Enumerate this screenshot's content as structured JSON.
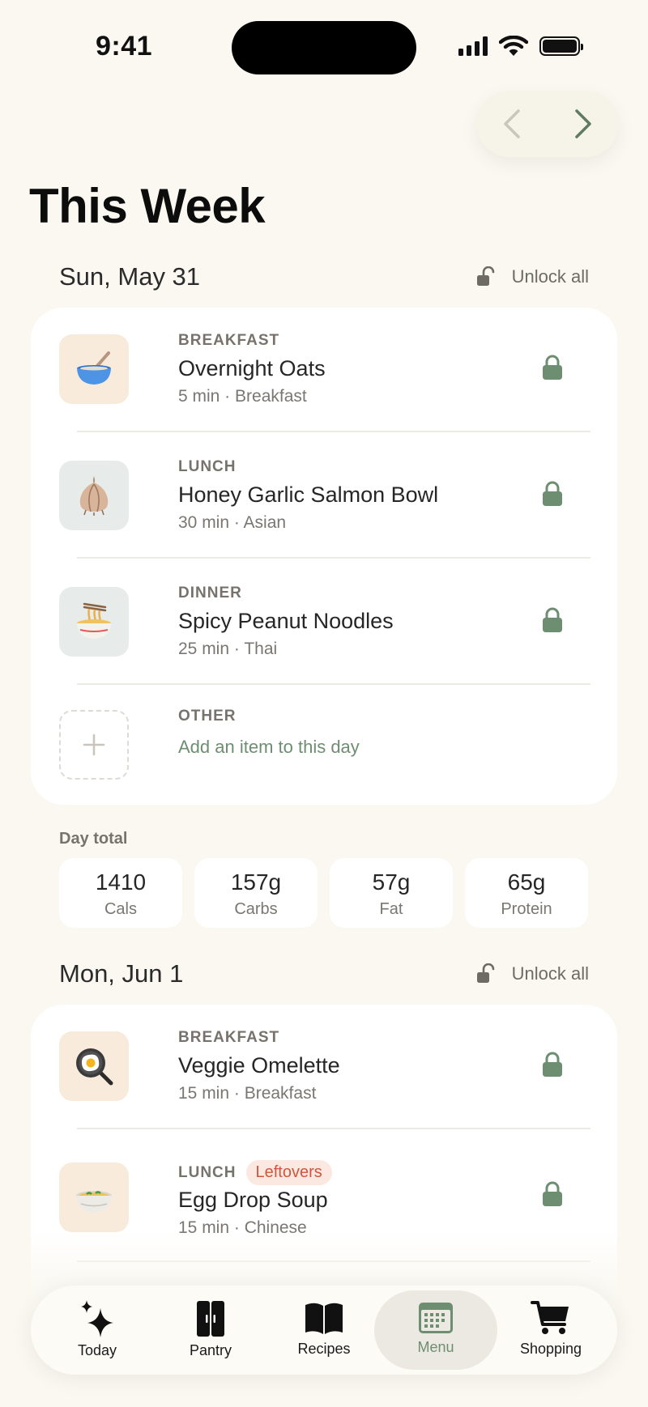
{
  "status_bar": {
    "time": "9:41"
  },
  "page_title": "This Week",
  "days": [
    {
      "title": "Sun, May 31",
      "unlock_label": "Unlock all",
      "meals": [
        {
          "type": "BREAKFAST",
          "name": "Overnight Oats",
          "sub": "5 min · Breakfast",
          "icon": "bowl-icon"
        },
        {
          "type": "LUNCH",
          "name": "Honey Garlic Salmon Bowl",
          "sub": "30 min · Asian",
          "icon": "garlic-icon"
        },
        {
          "type": "DINNER",
          "name": "Spicy Peanut Noodles",
          "sub": "25 min · Thai",
          "icon": "noodles-icon"
        }
      ],
      "other": {
        "type": "OTHER",
        "add_label": "Add an item to this day"
      },
      "day_total_label": "Day total",
      "totals": [
        {
          "value": "1410",
          "label": "Cals"
        },
        {
          "value": "157g",
          "label": "Carbs"
        },
        {
          "value": "57g",
          "label": "Fat"
        },
        {
          "value": "65g",
          "label": "Protein"
        }
      ]
    },
    {
      "title": "Mon, Jun 1",
      "unlock_label": "Unlock all",
      "meals": [
        {
          "type": "BREAKFAST",
          "name": "Veggie Omelette",
          "sub": "15 min · Breakfast",
          "icon": "frying-pan-egg-icon"
        },
        {
          "type": "LUNCH",
          "badge": "Leftovers",
          "name": "Egg Drop Soup",
          "sub": "15 min · Chinese",
          "icon": "soup-bowl-icon"
        }
      ]
    }
  ],
  "tabs": [
    {
      "label": "Today",
      "icon": "sparkles-icon"
    },
    {
      "label": "Pantry",
      "icon": "cabinet-icon"
    },
    {
      "label": "Recipes",
      "icon": "open-book-icon"
    },
    {
      "label": "Menu",
      "icon": "calendar-icon",
      "active": true
    },
    {
      "label": "Shopping",
      "icon": "cart-icon"
    }
  ],
  "colors": {
    "background": "#FAF8F1",
    "accent_green": "#6E8E72",
    "leftovers_text": "#D0553E",
    "leftovers_bg": "#FBE8E1"
  }
}
